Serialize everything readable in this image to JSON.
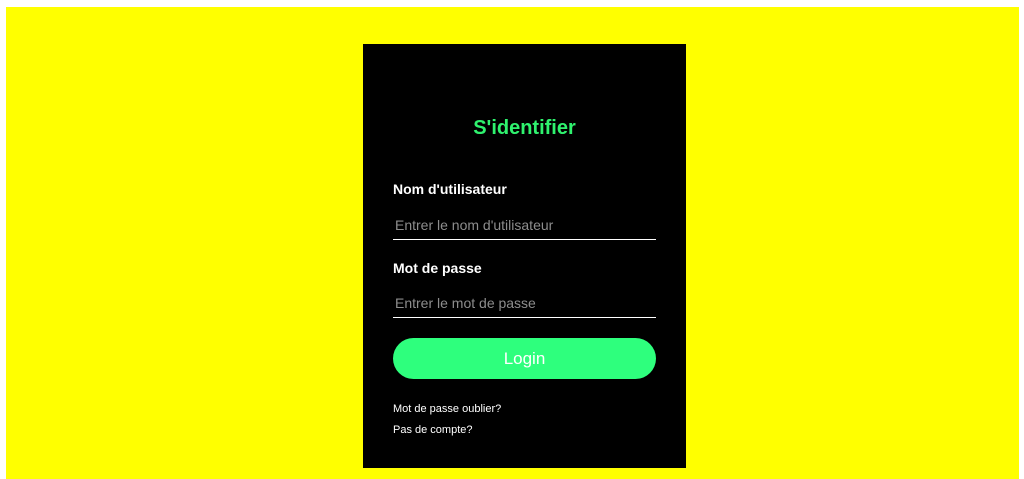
{
  "login": {
    "title": "S'identifier",
    "username": {
      "label": "Nom d'utilisateur",
      "placeholder": "Entrer le nom d'utilisateur",
      "value": ""
    },
    "password": {
      "label": "Mot de passe",
      "placeholder": "Entrer le mot de passe",
      "value": ""
    },
    "submit_label": "Login",
    "forgot_link": "Mot de passe oublier?",
    "signup_link": "Pas de compte?"
  },
  "colors": {
    "page_background": "#ffff00",
    "card_background": "#000000",
    "title": "#2ff26e",
    "button": "#2eff7d",
    "text": "#ffffff"
  }
}
